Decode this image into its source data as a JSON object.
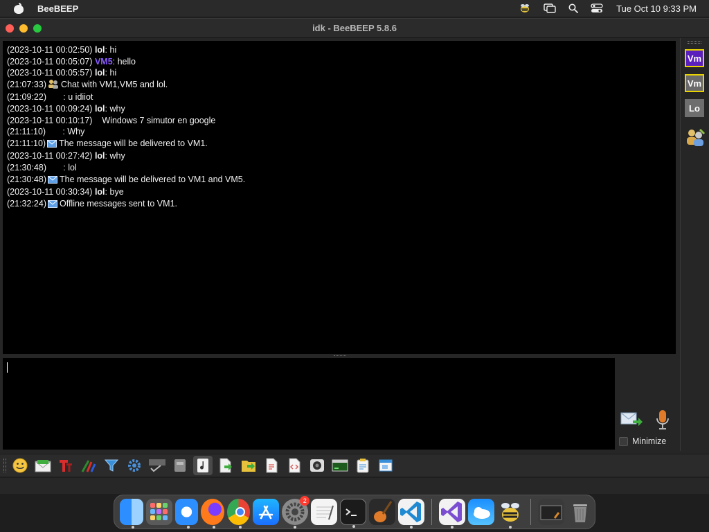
{
  "menubar": {
    "app_name": "BeeBEEP",
    "clock": "Tue Oct 10  9:33 PM"
  },
  "window": {
    "title": "idk - BeeBEEP 5.8.6"
  },
  "chat": {
    "messages": [
      {
        "time": "(2023-10-11 00:02:50)",
        "user": "lol",
        "text": ": hi"
      },
      {
        "time": "(2023-10-11 00:05:07)",
        "user": "VM5",
        "text": ": hello"
      },
      {
        "time": "(2023-10-11 00:05:57)",
        "user": "lol",
        "text": ": hi"
      },
      {
        "time": "(21:07:33)",
        "text": "Chat with VM1,VM5 and lol."
      },
      {
        "time": "(21:09:22)",
        "text": ": u idiiot"
      },
      {
        "time": "(2023-10-11 00:09:24)",
        "user": "lol",
        "text": ": why"
      },
      {
        "time": "(2023-10-11 00:10:17)",
        "text": "Windows 7 simutor en google"
      },
      {
        "time": "(21:11:10)",
        "text": ": Why"
      },
      {
        "time": "(21:11:10)",
        "text": "The message will be delivered to VM1."
      },
      {
        "time": "(2023-10-11 00:27:42)",
        "user": "lol",
        "text": ": why"
      },
      {
        "time": "(21:30:48)",
        "text": ": lol"
      },
      {
        "time": "(21:30:48)",
        "text": "The message will be delivered to VM1 and VM5."
      },
      {
        "time": "(2023-10-11 00:30:34)",
        "user": "lol",
        "text": ": bye"
      },
      {
        "time": "(21:32:24)",
        "text": "Offline messages sent to VM1."
      }
    ]
  },
  "input": {
    "value": ""
  },
  "actions": {
    "minimize_label": "Minimize"
  },
  "users": [
    {
      "label": "Vm",
      "color": "#5b1fbd"
    },
    {
      "label": "Vm",
      "color": "#6a6a6a"
    },
    {
      "label": "Lo",
      "color": "#6e6e6e"
    }
  ],
  "toolbar_icons": [
    "smiley-icon",
    "envelope-icon",
    "font-icon",
    "color-picker-icon",
    "filter-icon",
    "settings-gear-icon",
    "spellcheck-icon",
    "dictionary-icon",
    "note-icon",
    "send-file-icon",
    "share-folder-icon",
    "document-icon",
    "code-icon",
    "screenshot-icon",
    "terminal-window-icon",
    "clipboard-icon",
    "window-icon"
  ],
  "dock": {
    "settings_badge": "2",
    "apps": [
      "finder",
      "launchpad",
      "safari",
      "firefox",
      "chrome",
      "app-store",
      "system-settings",
      "textedit",
      "terminal",
      "garageband",
      "vscode",
      "visual-studio",
      "weather",
      "beebeep",
      "screen-capture",
      "trash"
    ]
  }
}
